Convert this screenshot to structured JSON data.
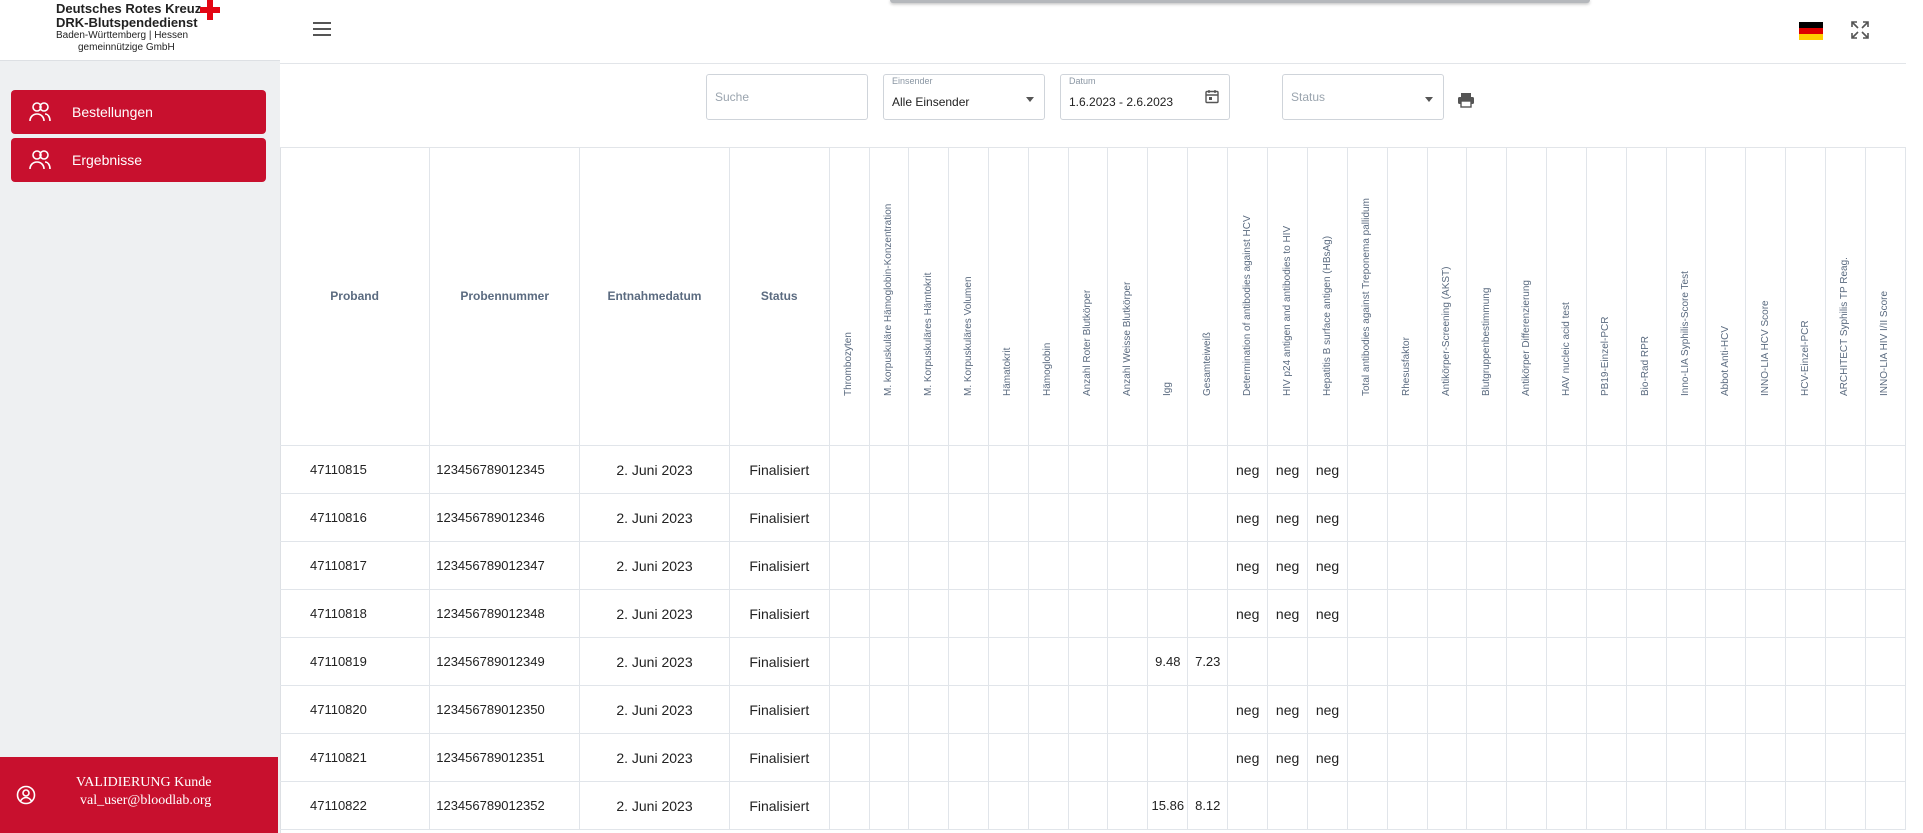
{
  "brand": {
    "line1": "Deutsches Rotes Kreuz",
    "line2": "DRK-Blutspendedienst",
    "line3": "Baden-Württemberg | Hessen",
    "line4": "gemeinnützige GmbH",
    "accent_color": "#c8102e"
  },
  "nav": {
    "items": [
      {
        "label": "Bestellungen",
        "icon": "users-icon"
      },
      {
        "label": "Ergebnisse",
        "icon": "users-icon"
      }
    ]
  },
  "user": {
    "name": "VALIDIERUNG Kunde",
    "email": "val_user@bloodlab.org",
    "icon": "user-circle-icon"
  },
  "topbar": {
    "menu_icon": "hamburger-menu-icon",
    "language": "de",
    "fullscreen_icon": "fullscreen-icon"
  },
  "filters": {
    "search_placeholder": "Suche",
    "einsender_label": "Einsender",
    "einsender_value": "Alle Einsender",
    "datum_label": "Datum",
    "datum_value": "1.6.2023 - 2.6.2023",
    "status_placeholder": "Status",
    "print_icon": "printer-icon",
    "calendar_icon": "calendar-icon"
  },
  "table": {
    "fixed_headers": [
      "Proband",
      "Probennummer",
      "Entnahmedatum",
      "Status"
    ],
    "rotated_headers": [
      "Thrombozyten",
      "M. korpuskuläre Hämoglobin-Konzentration",
      "M. Korpuskuläres Hämtokrit",
      "M. Korpuskuläres Volumen",
      "Hämatokrit",
      "Hämoglobin",
      "Anzahl Roter Blutkörper",
      "Anzahl Weisse Blutkörper",
      "Igg",
      "Gesamteiweiß",
      "Determination of antibodies against HCV",
      "HIV p24 antigen and antibodies to HIV",
      "Hepatitis B surface antigen (HBsAg)",
      "Total antibodies against Treponema pallidum",
      "Rhesusfaktor",
      "Antikörper-Screening (AKST)",
      "Blutgruppenbestimmung",
      "Antikörper Differenzierung",
      "HAV nucleic acid test",
      "PB19-Einzel-PCR",
      "Bio-Rad RPR",
      "Inno-LIA Syphilis-Score Test",
      "Abbot Anti-HCV",
      "INNO-LIA HCV Score",
      "HCV-Einzel-PCR",
      "ARCHITECT Syphilis TP Reag.",
      "INNO-LIA HIV I/II Score"
    ],
    "rows": [
      {
        "proband": "47110815",
        "nummer": "123456789012345",
        "datum": "2. Juni 2023",
        "status": "Finalisiert",
        "igg": "",
        "eiweiss": "",
        "hcv": "neg",
        "hiv": "neg",
        "hbsag": "neg"
      },
      {
        "proband": "47110816",
        "nummer": "123456789012346",
        "datum": "2. Juni 2023",
        "status": "Finalisiert",
        "igg": "",
        "eiweiss": "",
        "hcv": "neg",
        "hiv": "neg",
        "hbsag": "neg"
      },
      {
        "proband": "47110817",
        "nummer": "123456789012347",
        "datum": "2. Juni 2023",
        "status": "Finalisiert",
        "igg": "",
        "eiweiss": "",
        "hcv": "neg",
        "hiv": "neg",
        "hbsag": "neg"
      },
      {
        "proband": "47110818",
        "nummer": "123456789012348",
        "datum": "2. Juni 2023",
        "status": "Finalisiert",
        "igg": "",
        "eiweiss": "",
        "hcv": "neg",
        "hiv": "neg",
        "hbsag": "neg"
      },
      {
        "proband": "47110819",
        "nummer": "123456789012349",
        "datum": "2. Juni 2023",
        "status": "Finalisiert",
        "igg": "9.48",
        "eiweiss": "7.23",
        "hcv": "",
        "hiv": "",
        "hbsag": ""
      },
      {
        "proband": "47110820",
        "nummer": "123456789012350",
        "datum": "2. Juni 2023",
        "status": "Finalisiert",
        "igg": "",
        "eiweiss": "",
        "hcv": "neg",
        "hiv": "neg",
        "hbsag": "neg"
      },
      {
        "proband": "47110821",
        "nummer": "123456789012351",
        "datum": "2. Juni 2023",
        "status": "Finalisiert",
        "igg": "",
        "eiweiss": "",
        "hcv": "neg",
        "hiv": "neg",
        "hbsag": "neg"
      },
      {
        "proband": "47110822",
        "nummer": "123456789012352",
        "datum": "2. Juni 2023",
        "status": "Finalisiert",
        "igg": "15.86",
        "eiweiss": "8.12",
        "hcv": "",
        "hiv": "",
        "hbsag": ""
      }
    ]
  }
}
